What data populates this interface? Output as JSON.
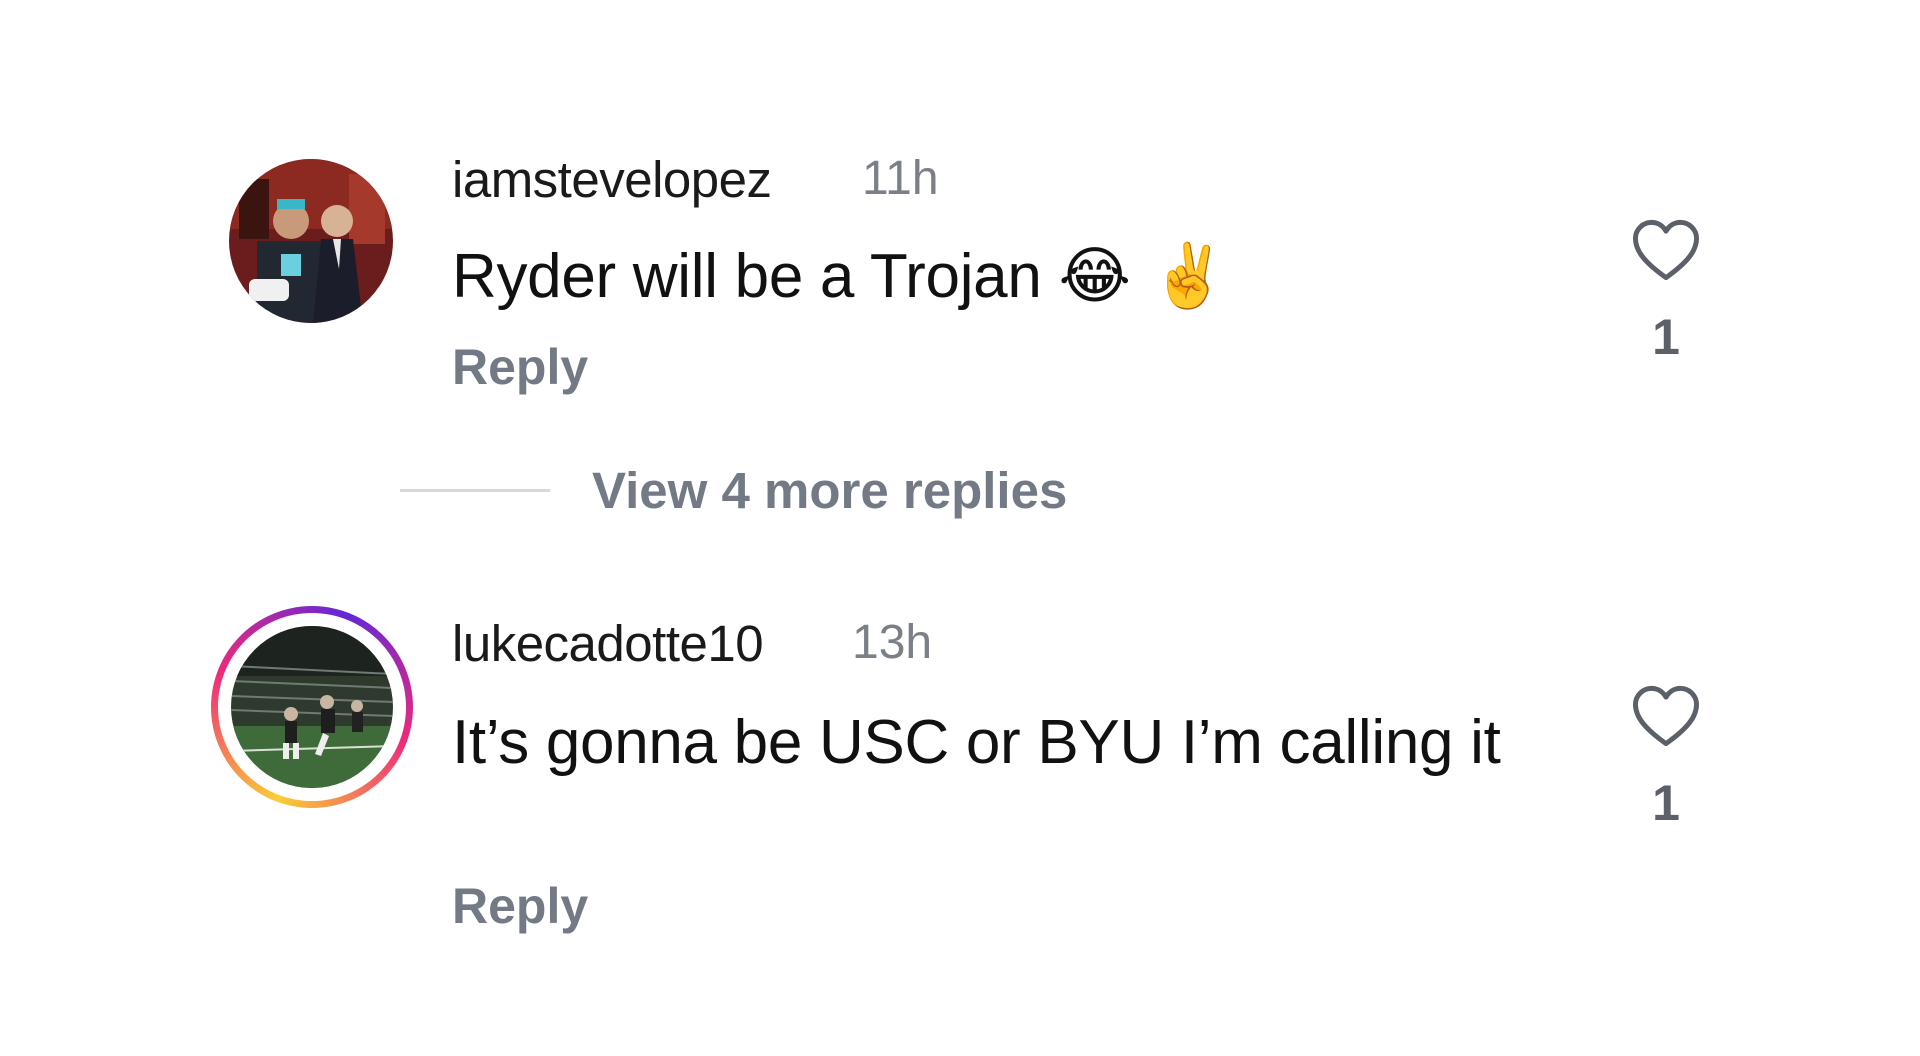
{
  "comments": [
    {
      "username": "iamstevelopez",
      "time": "11h",
      "text": "Ryder will be a Trojan",
      "emojis": "😂 ✌️",
      "reply_label": "Reply",
      "like_icon": "heart-outline-icon",
      "like_count": "1",
      "avatar_has_story": false
    },
    {
      "username": "lukecadotte10",
      "time": "13h",
      "text": "It’s gonna be USC or BYU I’m calling it",
      "reply_label": "Reply",
      "like_icon": "heart-outline-icon",
      "like_count": "1",
      "avatar_has_story": true
    }
  ],
  "view_more": {
    "label": "View 4 more replies"
  },
  "colors": {
    "secondary_text": "#737a85",
    "story_ring": [
      "#f9ce34",
      "#ee2a7b",
      "#6228d7"
    ]
  }
}
